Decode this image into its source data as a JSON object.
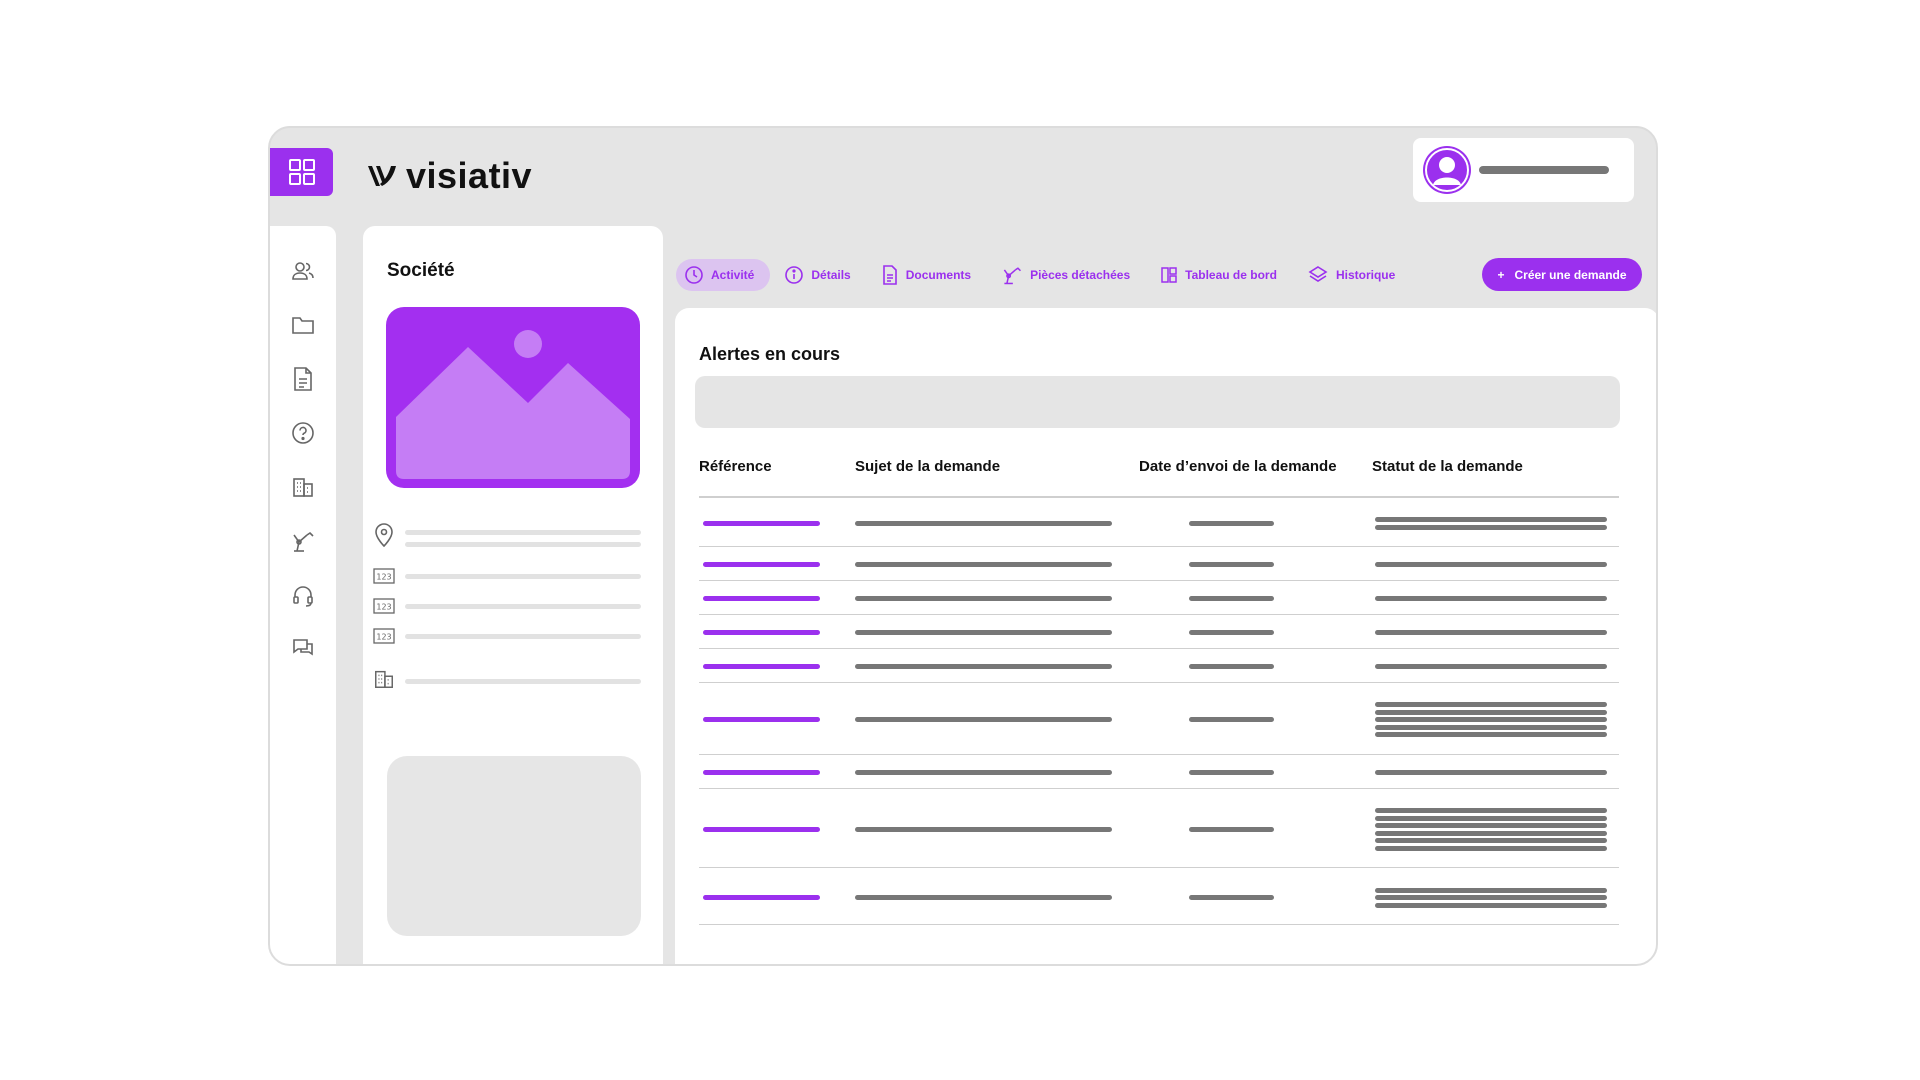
{
  "brand": {
    "name": "visiativ",
    "accent": "#9b30ee"
  },
  "header": {
    "apps_icon": "grid-icon",
    "user_icon": "user-avatar-icon"
  },
  "sidebar": {
    "items": [
      {
        "name": "users-icon"
      },
      {
        "name": "folder-icon"
      },
      {
        "name": "document-icon"
      },
      {
        "name": "help-icon"
      },
      {
        "name": "buildings-icon"
      },
      {
        "name": "robot-arm-icon"
      },
      {
        "name": "headset-icon"
      },
      {
        "name": "chat-icon"
      }
    ]
  },
  "company_panel": {
    "title": "Société",
    "info_icons": [
      "location-pin-icon",
      "number-123-icon",
      "number-123-icon",
      "number-123-icon",
      "building-icon"
    ]
  },
  "tabs": [
    {
      "label": "Activité",
      "icon": "clock-icon",
      "active": true
    },
    {
      "label": "Détails",
      "icon": "info-icon",
      "active": false
    },
    {
      "label": "Documents",
      "icon": "document-icon",
      "active": false
    },
    {
      "label": "Pièces détachées",
      "icon": "robot-arm-icon",
      "active": false
    },
    {
      "label": "Tableau de bord",
      "icon": "dashboard-icon",
      "active": false
    },
    {
      "label": "Historique",
      "icon": "layers-icon",
      "active": false
    }
  ],
  "actions": {
    "create_label": "Créer une demande",
    "create_symbol": "+"
  },
  "alerts": {
    "title": "Alertes en cours",
    "columns": [
      "Référence",
      "Sujet de la demande",
      "Date d’envoi de la demande",
      "Statut de la demande"
    ],
    "rows": [
      {
        "status_lines": 2
      },
      {
        "status_lines": 1
      },
      {
        "status_lines": 1
      },
      {
        "status_lines": 1
      },
      {
        "status_lines": 1
      },
      {
        "status_lines": 5
      },
      {
        "status_lines": 1
      },
      {
        "status_lines": 6
      },
      {
        "status_lines": 3
      }
    ]
  }
}
